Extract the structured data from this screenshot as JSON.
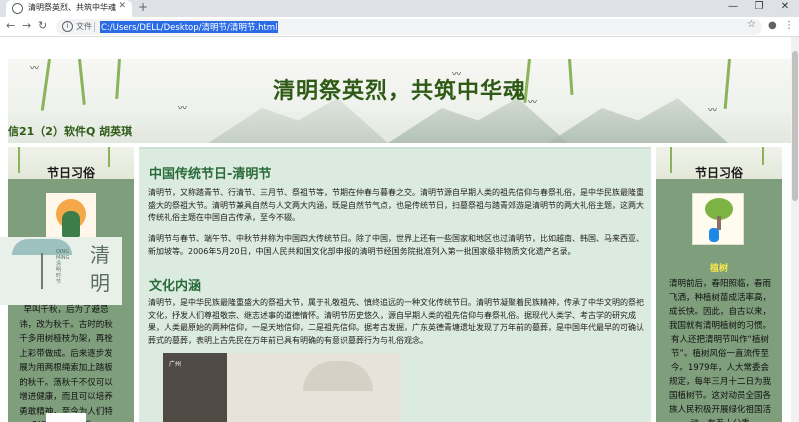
{
  "browser": {
    "tab_title": "清明祭英烈、共筑中华魂",
    "scheme_label": "文件",
    "url": "C:/Users/DELL/Desktop/清明节/清明节.html"
  },
  "banner": {
    "title": "清明祭英烈，共筑中华魂",
    "author": "信21（2）软件Q 胡英琪"
  },
  "left": {
    "heading": "节日习俗",
    "poster_small": "QING MING 清明时节",
    "poster_big": "清明",
    "text": "早叫千秋，后为了避忌讳，改为秋千。古时的秋千多用树桠枝为架，再栓上彩带做成。后来逐步发展为用两根绳索加上踏板的秋千。荡秋千不仅可以增进健康，而且可以培养勇敢精神，至今为人们特别是儿童所喜爱。"
  },
  "right": {
    "heading": "节日习俗",
    "subheading": "植树",
    "text": "清明前后，春阳照临，春雨飞洒，种植树苗成活率高，成长快。因此，自古以来，我国就有清明植树的习惯。有人还把清明节叫作“植树节”。植树风俗一直流传至今。1979年，人大常委会规定，每年三月十二日为我国植树节。这对动员全国各族人民积极开展绿化祖国活动，有着十分重"
  },
  "main": {
    "title1": "中国传统节日-清明节",
    "para1": "清明节，又称踏青节、行清节、三月节、祭祖节等，节期在仲春与暮春之交。清明节源自早期人类的祖先信仰与春祭礼俗，是中华民族最隆重盛大的祭祖大节。清明节兼具自然与人文两大内涵，既是自然节气点，也是传统节日，扫墓祭祖与踏青郊游是清明节的两大礼俗主题，这两大传统礼俗主题在中国自古传承，至今不辍。",
    "para2": "清明节与春节、端午节、中秋节并称为中国四大传统节日。除了中国，世界上还有一些国家和地区也过清明节，比如越南、韩国、马来西亚、新加坡等。2006年5月20日，中国人民共和国文化部申报的清明节经国务院批准列入第一批国家级非物质文化遗产名录。",
    "title2": "文化内涵",
    "para3": "清明节，是中华民族最隆重盛大的祭祖大节，属于礼敬祖先、慎终追远的一种文化传统节日。清明节凝聚着民族精神，传承了中华文明的祭祀文化，抒发人们尊祖敬宗、继志述事的道德情怀。清明节历史悠久，源自早期人类的祖先信仰与春祭礼俗。据现代人类学、考古学的研究成果，人类最原始的两种信仰，一是天地信仰，二是祖先信仰。据考古发掘，广东英德青塘遗址发现了万年前的墓葬，是中国年代最早的可确认葬式的墓葬，表明上古先民在万年前已具有明确的有意识墓葬行为与礼俗观念。",
    "photo_caption": "广州"
  }
}
